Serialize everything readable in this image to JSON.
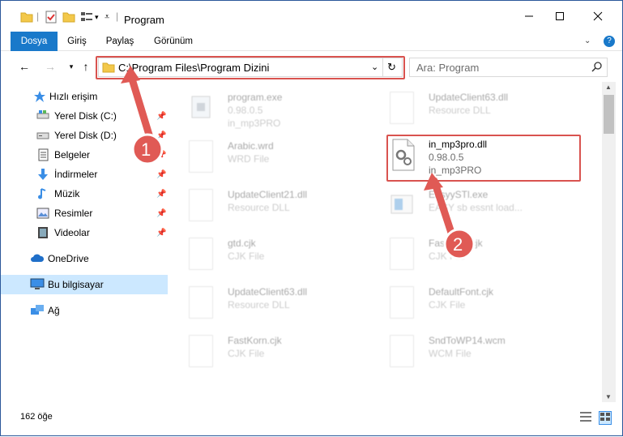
{
  "window": {
    "title": "Program",
    "minimize_icon": "minimize-icon",
    "maximize_icon": "maximize-icon",
    "close_icon": "close-icon"
  },
  "ribbon": {
    "tabs": [
      {
        "label": "Dosya",
        "active": true
      },
      {
        "label": "Giriş",
        "active": false
      },
      {
        "label": "Paylaş",
        "active": false
      },
      {
        "label": "Görünüm",
        "active": false
      }
    ],
    "help_icon": "help-icon"
  },
  "address": {
    "path": "C:\\Program Files\\Program Dizini",
    "search_placeholder": "Ara: Program"
  },
  "sidebar": {
    "items": [
      {
        "label": "Hızlı erişim",
        "icon": "star-icon"
      },
      {
        "label": "Yerel Disk (C:)",
        "icon": "drive-icon",
        "pinned": true
      },
      {
        "label": "Yerel Disk (D:)",
        "icon": "drive-icon",
        "pinned": true
      },
      {
        "label": "Belgeler",
        "icon": "documents-icon",
        "pinned": true
      },
      {
        "label": "İndirmeler",
        "icon": "download-icon",
        "pinned": true
      },
      {
        "label": "Müzik",
        "icon": "music-icon",
        "pinned": true
      },
      {
        "label": "Resimler",
        "icon": "pictures-icon",
        "pinned": true
      },
      {
        "label": "Videolar",
        "icon": "videos-icon",
        "pinned": true
      },
      {
        "label": "OneDrive",
        "icon": "cloud-icon"
      },
      {
        "label": "Bu bilgisayar",
        "icon": "computer-icon",
        "selected": true
      },
      {
        "label": "Ağ",
        "icon": "network-icon"
      }
    ]
  },
  "files": [
    {
      "name": "program.exe",
      "line1": "0.98.0.5",
      "line2": "in_mp3PRO",
      "faded": true
    },
    {
      "name": "UpdateClient63.dll",
      "line1": "Resource DLL",
      "line2": "",
      "faded": true
    },
    {
      "name": "Arabic.wrd",
      "line1": "WRD File",
      "line2": "",
      "faded": true
    },
    {
      "name": "in_mp3pro.dll",
      "line1": "0.98.0.5",
      "line2": "in_mp3PRO",
      "faded": false
    },
    {
      "name": "UpdateClient21.dll",
      "line1": "Resource DLL",
      "line2": "",
      "faded": true
    },
    {
      "name": "EasyySTl.exe",
      "line1": "EASY sb essnt load...",
      "line2": "",
      "faded": true
    },
    {
      "name": "gtd.cjk",
      "line1": "CJK File",
      "line2": "",
      "faded": true
    },
    {
      "name": "FastKorn.cjk",
      "line1": "CJK File",
      "line2": "",
      "faded": true
    },
    {
      "name": "UpdateClient63.dll",
      "line1": "Resource DLL",
      "line2": "",
      "faded": true
    },
    {
      "name": "DefaultFont.cjk",
      "line1": "CJK File",
      "line2": "",
      "faded": true
    },
    {
      "name": "FastKorn.cjk",
      "line1": "CJK File",
      "line2": "",
      "faded": true
    },
    {
      "name": "SndToWP14.wcm",
      "line1": "WCM File",
      "line2": "",
      "faded": true
    }
  ],
  "annotations": {
    "step1": "1",
    "step2": "2",
    "color": "#d9534f"
  },
  "status": {
    "count": "162 öğe"
  }
}
